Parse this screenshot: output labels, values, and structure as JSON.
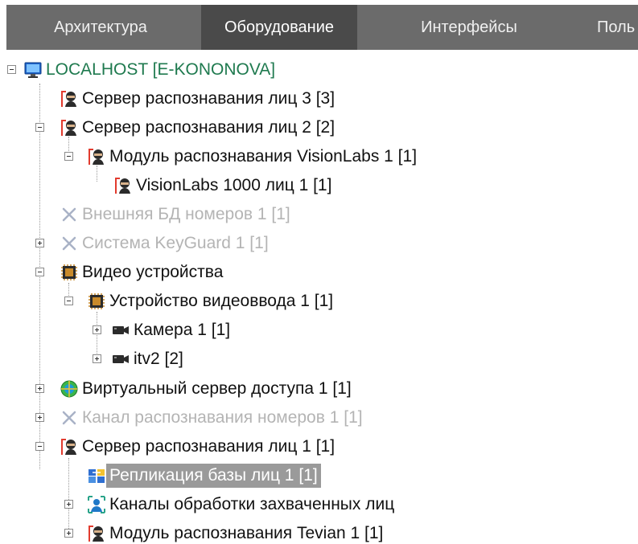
{
  "tabs": [
    {
      "label": "Архитектура",
      "active": false
    },
    {
      "label": "Оборудование",
      "active": true
    },
    {
      "label": "Интерфейсы",
      "active": false
    },
    {
      "label": "Поль",
      "active": false
    }
  ],
  "tree": {
    "root": "LOCALHOST [E-KONONOVA]",
    "nodes": [
      {
        "label": "Сервер распознавания лиц 3 [3]",
        "icon": "face-server-icon",
        "state": "normal"
      },
      {
        "label": "Сервер распознавания лиц 2 [2]",
        "icon": "face-server-icon",
        "state": "expanded"
      },
      {
        "label": "Модуль распознавания VisionLabs 1 [1]",
        "icon": "face-server-icon",
        "state": "expanded"
      },
      {
        "label": "VisionLabs 1000 лиц 1 [1]",
        "icon": "face-server-icon",
        "state": "normal"
      },
      {
        "label": "Внешняя БД номеров 1 [1]",
        "icon": "disabled-x-icon",
        "state": "disabled"
      },
      {
        "label": "Система KeyGuard 1 [1]",
        "icon": "disabled-x-icon",
        "state": "disabled"
      },
      {
        "label": "Видео устройства",
        "icon": "chip-icon",
        "state": "expanded"
      },
      {
        "label": "Устройство видеоввода 1 [1]",
        "icon": "chip-icon",
        "state": "expanded"
      },
      {
        "label": "Камера 1 [1]",
        "icon": "camera-icon",
        "state": "collapsed"
      },
      {
        "label": "itv2 [2]",
        "icon": "camera-icon",
        "state": "collapsed"
      },
      {
        "label": "Виртуальный сервер доступа 1 [1]",
        "icon": "globe-icon",
        "state": "collapsed"
      },
      {
        "label": "Канал распознавания номеров 1 [1]",
        "icon": "disabled-x-icon",
        "state": "disabled"
      },
      {
        "label": "Сервер распознавания лиц 1 [1]",
        "icon": "face-server-icon",
        "state": "expanded"
      },
      {
        "label": "Репликация базы лиц 1 [1]",
        "icon": "replication-icon",
        "state": "selected"
      },
      {
        "label": "Каналы обработки захваченных лиц",
        "icon": "person-channel-icon",
        "state": "collapsed"
      },
      {
        "label": "Модуль распознавания Tevian 1 [1]",
        "icon": "face-server-icon",
        "state": "collapsed"
      }
    ]
  },
  "colors": {
    "tab_bg": "#6b6b6b",
    "tab_active_bg": "#4a4a4a",
    "root_text": "#1f7a4f",
    "disabled_text": "#b4b4b4",
    "selected_bg": "#9a9a9a",
    "face_icon_accent": "#e23b2e"
  }
}
